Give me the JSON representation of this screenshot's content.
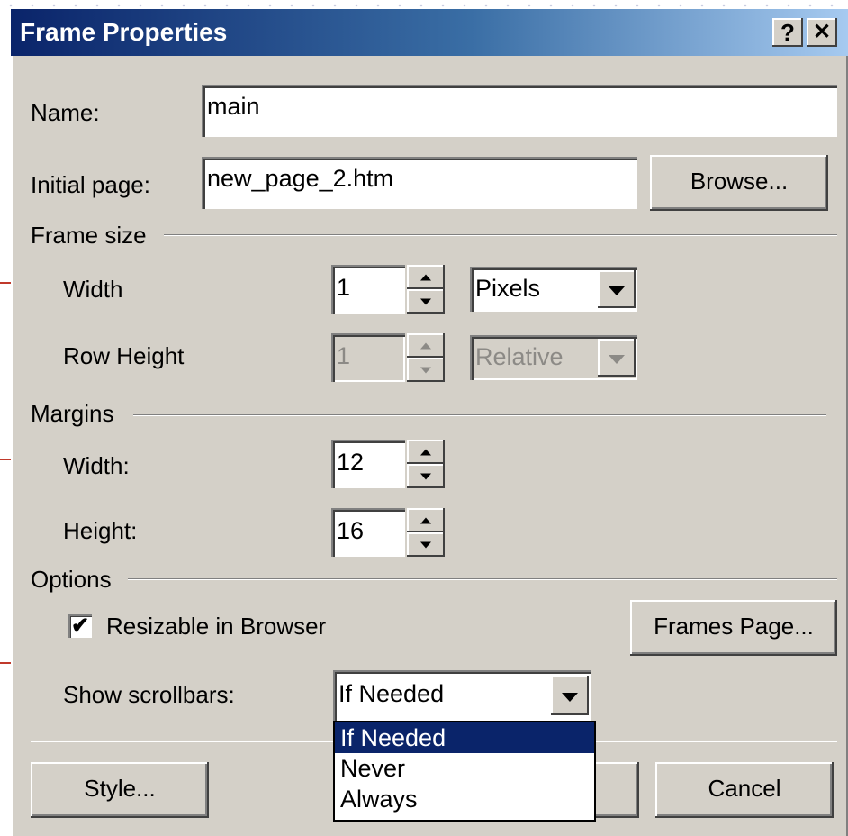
{
  "window": {
    "title": "Frame Properties",
    "help_label": "?",
    "close_label": "✕"
  },
  "name_field": {
    "label": "Name:",
    "value": "main"
  },
  "initial_page": {
    "label": "Initial page:",
    "value": "new_page_2.htm",
    "browse_label": "Browse..."
  },
  "frame_size": {
    "heading": "Frame size",
    "width_label": "Width",
    "width_value": "1",
    "width_unit": "Pixels",
    "row_height_label": "Row Height",
    "row_height_value": "1",
    "row_height_unit": "Relative"
  },
  "margins": {
    "heading": "Margins",
    "width_label": "Width:",
    "width_value": "12",
    "height_label": "Height:",
    "height_value": "16"
  },
  "options": {
    "heading": "Options",
    "resizable_label": "Resizable in Browser",
    "resizable_checked": true,
    "check_glyph": "✔",
    "frames_page_label": "Frames Page...",
    "scrollbars_label": "Show scrollbars:",
    "scrollbars_value": "If Needed",
    "scrollbars_options": [
      "If Needed",
      "Never",
      "Always"
    ]
  },
  "footer": {
    "style_label": "Style...",
    "cancel_label": "Cancel"
  },
  "colors": {
    "title_start": "#0a246a",
    "title_end": "#a6caf0",
    "selection": "#0a246a",
    "face": "#d4d0c8"
  }
}
